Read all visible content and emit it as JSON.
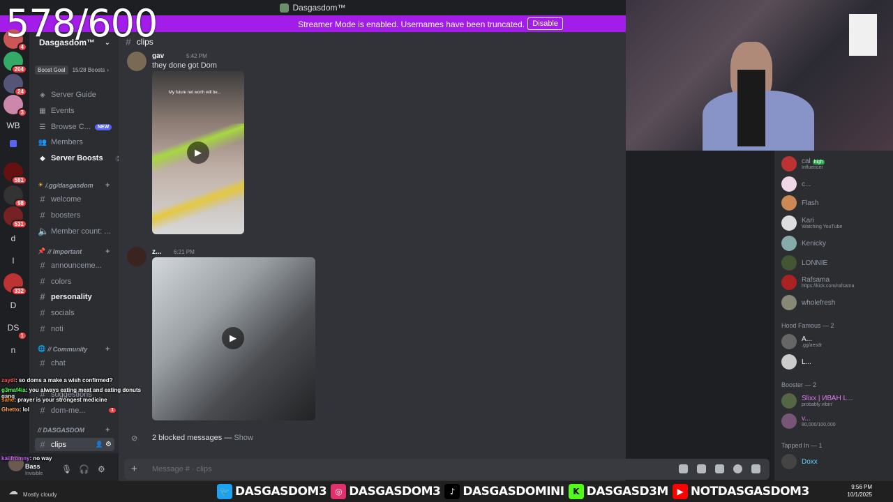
{
  "stream_overlay": {
    "counter": "578/600",
    "social_bar": [
      {
        "icon": "twitter-icon",
        "label": "DASGASDOM3"
      },
      {
        "icon": "instagram-icon",
        "label": "DASGASDOM3"
      },
      {
        "icon": "tiktok-icon",
        "label": "DASGASDOMINI"
      },
      {
        "icon": "kick-icon",
        "label": "DASGASD3M"
      },
      {
        "icon": "youtube-icon",
        "label": "NOTDASGASDOM3"
      }
    ],
    "chat_lines": [
      {
        "user": "zaydi",
        "text": ": so doms a make a wish confirmed?"
      },
      {
        "user": "g3maf4ia",
        "text": ": you always eating meat and eating donuts gang"
      },
      {
        "user": "sahe",
        "text": ": prayer is your strongest medicine"
      },
      {
        "user": "Ghetto",
        "text": ": lol"
      },
      {
        "user": "kaiifromny",
        "text": ": no way"
      }
    ]
  },
  "window": {
    "title": "Dasgasdom™",
    "streamer_banner": "Streamer Mode is enabled. Usernames have been truncated.",
    "disable_label": "Disable"
  },
  "server_rail": {
    "items": [
      {
        "label": "",
        "badge": "4"
      },
      {
        "label": "",
        "badge": "204"
      },
      {
        "label": "",
        "badge": "24"
      },
      {
        "label": "",
        "badge": "3"
      },
      {
        "label": "WB",
        "badge": ""
      },
      {
        "label": "",
        "badge": ""
      },
      {
        "label": "",
        "badge": "581"
      },
      {
        "label": "",
        "badge": "98"
      },
      {
        "label": "",
        "badge": "531"
      },
      {
        "label": "d",
        "badge": ""
      },
      {
        "label": "l",
        "badge": ""
      },
      {
        "label": "",
        "badge": "332"
      },
      {
        "label": "D",
        "badge": ""
      },
      {
        "label": "DS",
        "badge": "1"
      },
      {
        "label": "n",
        "badge": ""
      }
    ]
  },
  "sidebar": {
    "server_name": "Dasgasdom™",
    "boost_goal_label": "Boost Goal",
    "boost_progress": "15/28 Boosts",
    "nav": [
      {
        "icon": "compass-icon",
        "label": "Server Guide"
      },
      {
        "icon": "calendar-icon",
        "label": "Events"
      },
      {
        "icon": "browse-icon",
        "label": "Browse C...",
        "tag": "NEW"
      },
      {
        "icon": "members-icon",
        "label": "Members"
      },
      {
        "icon": "boost-icon",
        "label": "Server Boosts",
        "count": "1"
      }
    ],
    "categories": [
      {
        "name": "/.gg/dasgasdom",
        "channels": [
          "welcome",
          "boosters",
          "Member count: ..."
        ]
      },
      {
        "name": "// Important",
        "channels": [
          "announceme...",
          "colors",
          "personality",
          "socials",
          "noti"
        ]
      },
      {
        "name": "// Community",
        "channels": [
          "chat",
          "suggestions",
          "dom-me..."
        ]
      },
      {
        "name": "// DASGASDOM",
        "channels": [
          "clips"
        ]
      }
    ],
    "dom_me_badge": "1",
    "user_status_name": "Bass",
    "user_status": "Invisible"
  },
  "main": {
    "channel": "clips",
    "messages": [
      {
        "user": "gav",
        "time": "5:42 PM",
        "text": "they done got Dom",
        "video_caption": "My future net worth will be..."
      },
      {
        "user": "z...",
        "time": "6:21 PM",
        "text": ""
      }
    ],
    "blocked_text": "2 blocked messages —",
    "blocked_show": "Show",
    "input_placeholder": "Message # · clips"
  },
  "members": {
    "list": [
      {
        "name": "cal",
        "sub": "Influencer",
        "tag": "high"
      },
      {
        "name": "c...",
        "sub": ""
      },
      {
        "name": "Flash",
        "sub": ""
      },
      {
        "name": "Kari",
        "sub": "Watching YouTube"
      },
      {
        "name": "Kenicky",
        "sub": ""
      },
      {
        "name": "LONNIE",
        "sub": ""
      },
      {
        "name": "Rafsama",
        "sub": "https://kick.com/rafsama"
      },
      {
        "name": "wholefresh",
        "sub": ""
      }
    ],
    "sections": [
      {
        "title": "Hood Famous — 2",
        "members": [
          {
            "name": "A...",
            "sub": ".gg/aesdr"
          },
          {
            "name": "L...",
            "sub": ""
          }
        ]
      },
      {
        "title": "Booster — 2",
        "members": [
          {
            "name": "Slixx | ИВАН L...",
            "sub": "probably vibin'"
          },
          {
            "name": "v...",
            "sub": "80,000/100,000"
          }
        ]
      },
      {
        "title": "Tapped In — 1",
        "members": [
          {
            "name": "Doxx",
            "sub": ""
          }
        ]
      }
    ]
  },
  "taskbar": {
    "weather": "Mostly cloudy",
    "time": "9:56 PM",
    "date": "10/1/2025"
  },
  "colors": {
    "accent": "#5865f2",
    "streamer_banner": "#a21ee8",
    "badge_red": "#f23f43"
  }
}
